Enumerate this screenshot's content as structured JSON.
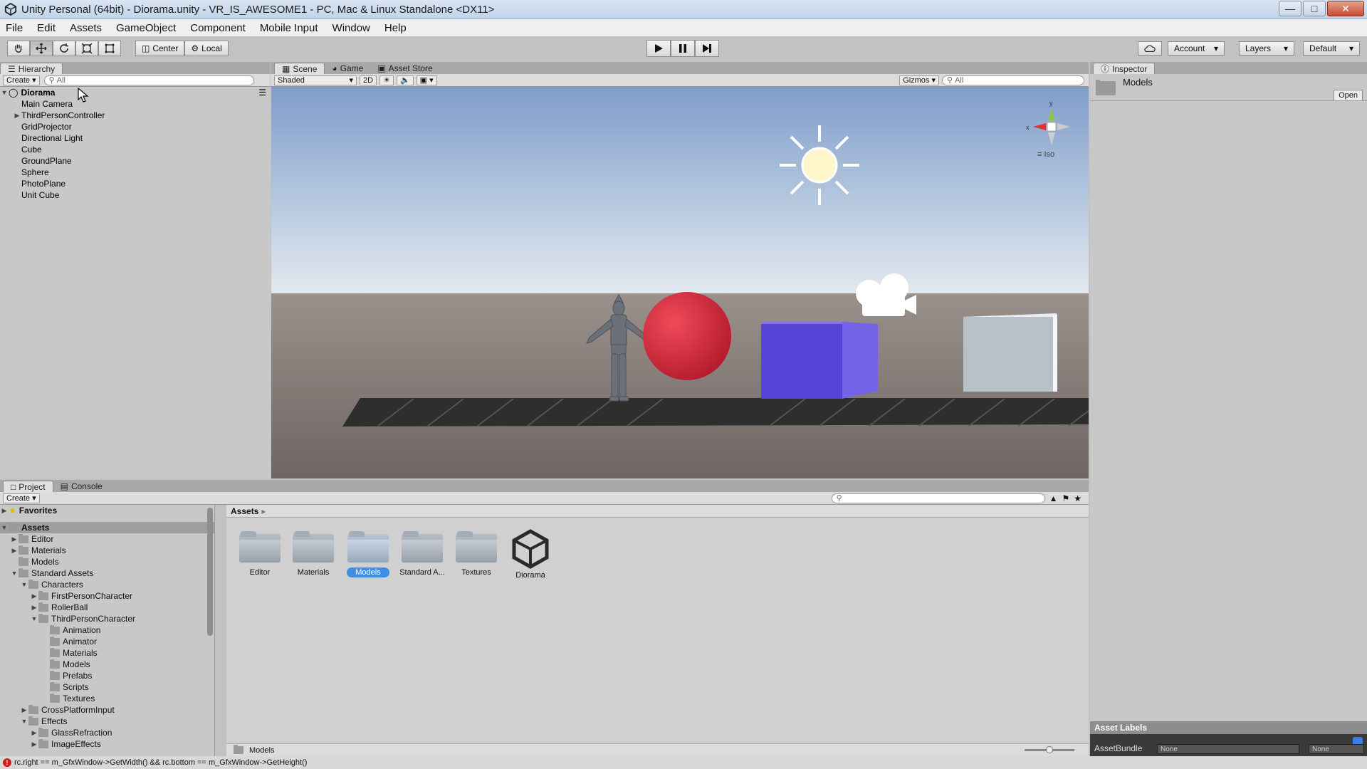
{
  "window": {
    "title": "Unity Personal (64bit) - Diorama.unity - VR_IS_AWESOME1 - PC, Mac & Linux Standalone <DX11>"
  },
  "menu": [
    "File",
    "Edit",
    "Assets",
    "GameObject",
    "Component",
    "Mobile Input",
    "Window",
    "Help"
  ],
  "toolbar": {
    "pivot_center": "Center",
    "pivot_local": "Local",
    "account": "Account",
    "layers": "Layers",
    "layout": "Default"
  },
  "hierarchy": {
    "tab": "Hierarchy",
    "create": "Create",
    "search_placeholder": "All",
    "scene_name": "Diorama",
    "items": [
      "Main Camera",
      "ThirdPersonController",
      "GridProjector",
      "Directional Light",
      "Cube",
      "GroundPlane",
      "Sphere",
      "PhotoPlane",
      "Unit Cube"
    ]
  },
  "scene": {
    "tabs": [
      "Scene",
      "Game",
      "Asset Store"
    ],
    "shading": "Shaded",
    "mode_2d": "2D",
    "gizmos": "Gizmos",
    "search_placeholder": "All",
    "projection": "Iso",
    "colors": {
      "sky_top": "#8aa7cf",
      "ground": "#7a6f6c",
      "sphere": "#d4263a",
      "cube": "#5a49d6",
      "unit_cube": "#b8c2cc"
    }
  },
  "inspector": {
    "tab": "Inspector",
    "title": "Models",
    "open": "Open",
    "asset_labels": "Asset Labels",
    "assetbundle_label": "AssetBundle",
    "assetbundle_value": "None",
    "assetbundle_variant": "None"
  },
  "project": {
    "tabs": [
      "Project",
      "Console"
    ],
    "create": "Create",
    "favorites": "Favorites",
    "assets_root": "Assets",
    "breadcrumb": "Assets",
    "tree": {
      "editor": "Editor",
      "materials": "Materials",
      "models": "Models",
      "standard_assets": "Standard Assets",
      "characters": "Characters",
      "first_person": "FirstPersonCharacter",
      "rollerball": "RollerBall",
      "third_person": "ThirdPersonCharacter",
      "animation": "Animation",
      "animator": "Animator",
      "tp_materials": "Materials",
      "tp_models": "Models",
      "prefabs": "Prefabs",
      "scripts": "Scripts",
      "textures": "Textures",
      "cross_platform": "CrossPlatformInput",
      "effects": "Effects",
      "glass_refraction": "GlassRefraction",
      "image_effects": "ImageEffects"
    },
    "grid": [
      {
        "label": "Editor"
      },
      {
        "label": "Materials"
      },
      {
        "label": "Models"
      },
      {
        "label": "Standard A..."
      },
      {
        "label": "Textures"
      },
      {
        "label": "Diorama"
      }
    ],
    "footer_path": "Models"
  },
  "status": {
    "message": "rc.right == m_GfxWindow->GetWidth() && rc.bottom == m_GfxWindow->GetHeight()"
  }
}
